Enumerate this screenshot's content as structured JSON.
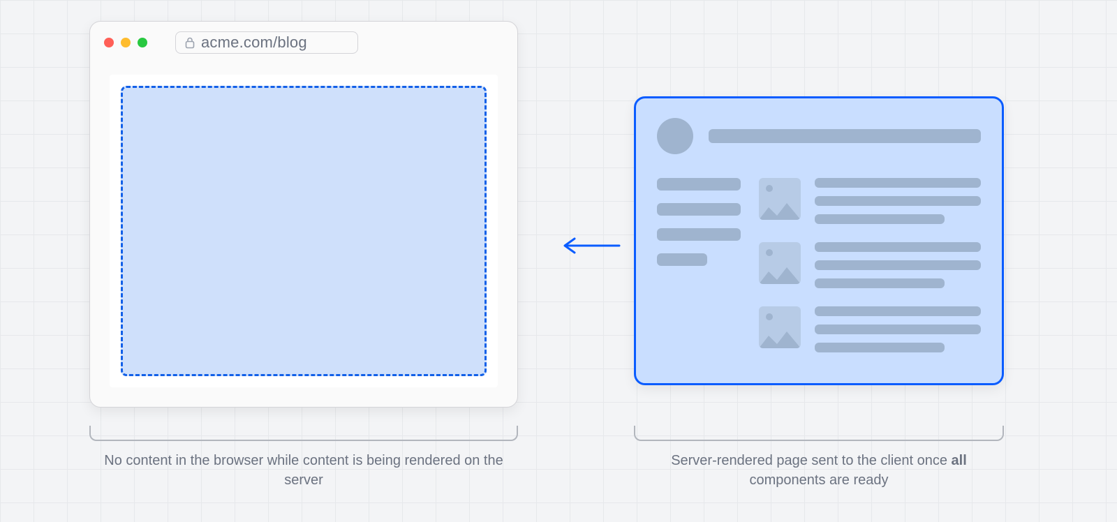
{
  "browser": {
    "url": "acme.com/blog"
  },
  "captions": {
    "left": "No content in the browser while content is being rendered on the server",
    "right_prefix": "Server-rendered page sent to the client once ",
    "right_bold": "all",
    "right_suffix": " components are ready"
  }
}
